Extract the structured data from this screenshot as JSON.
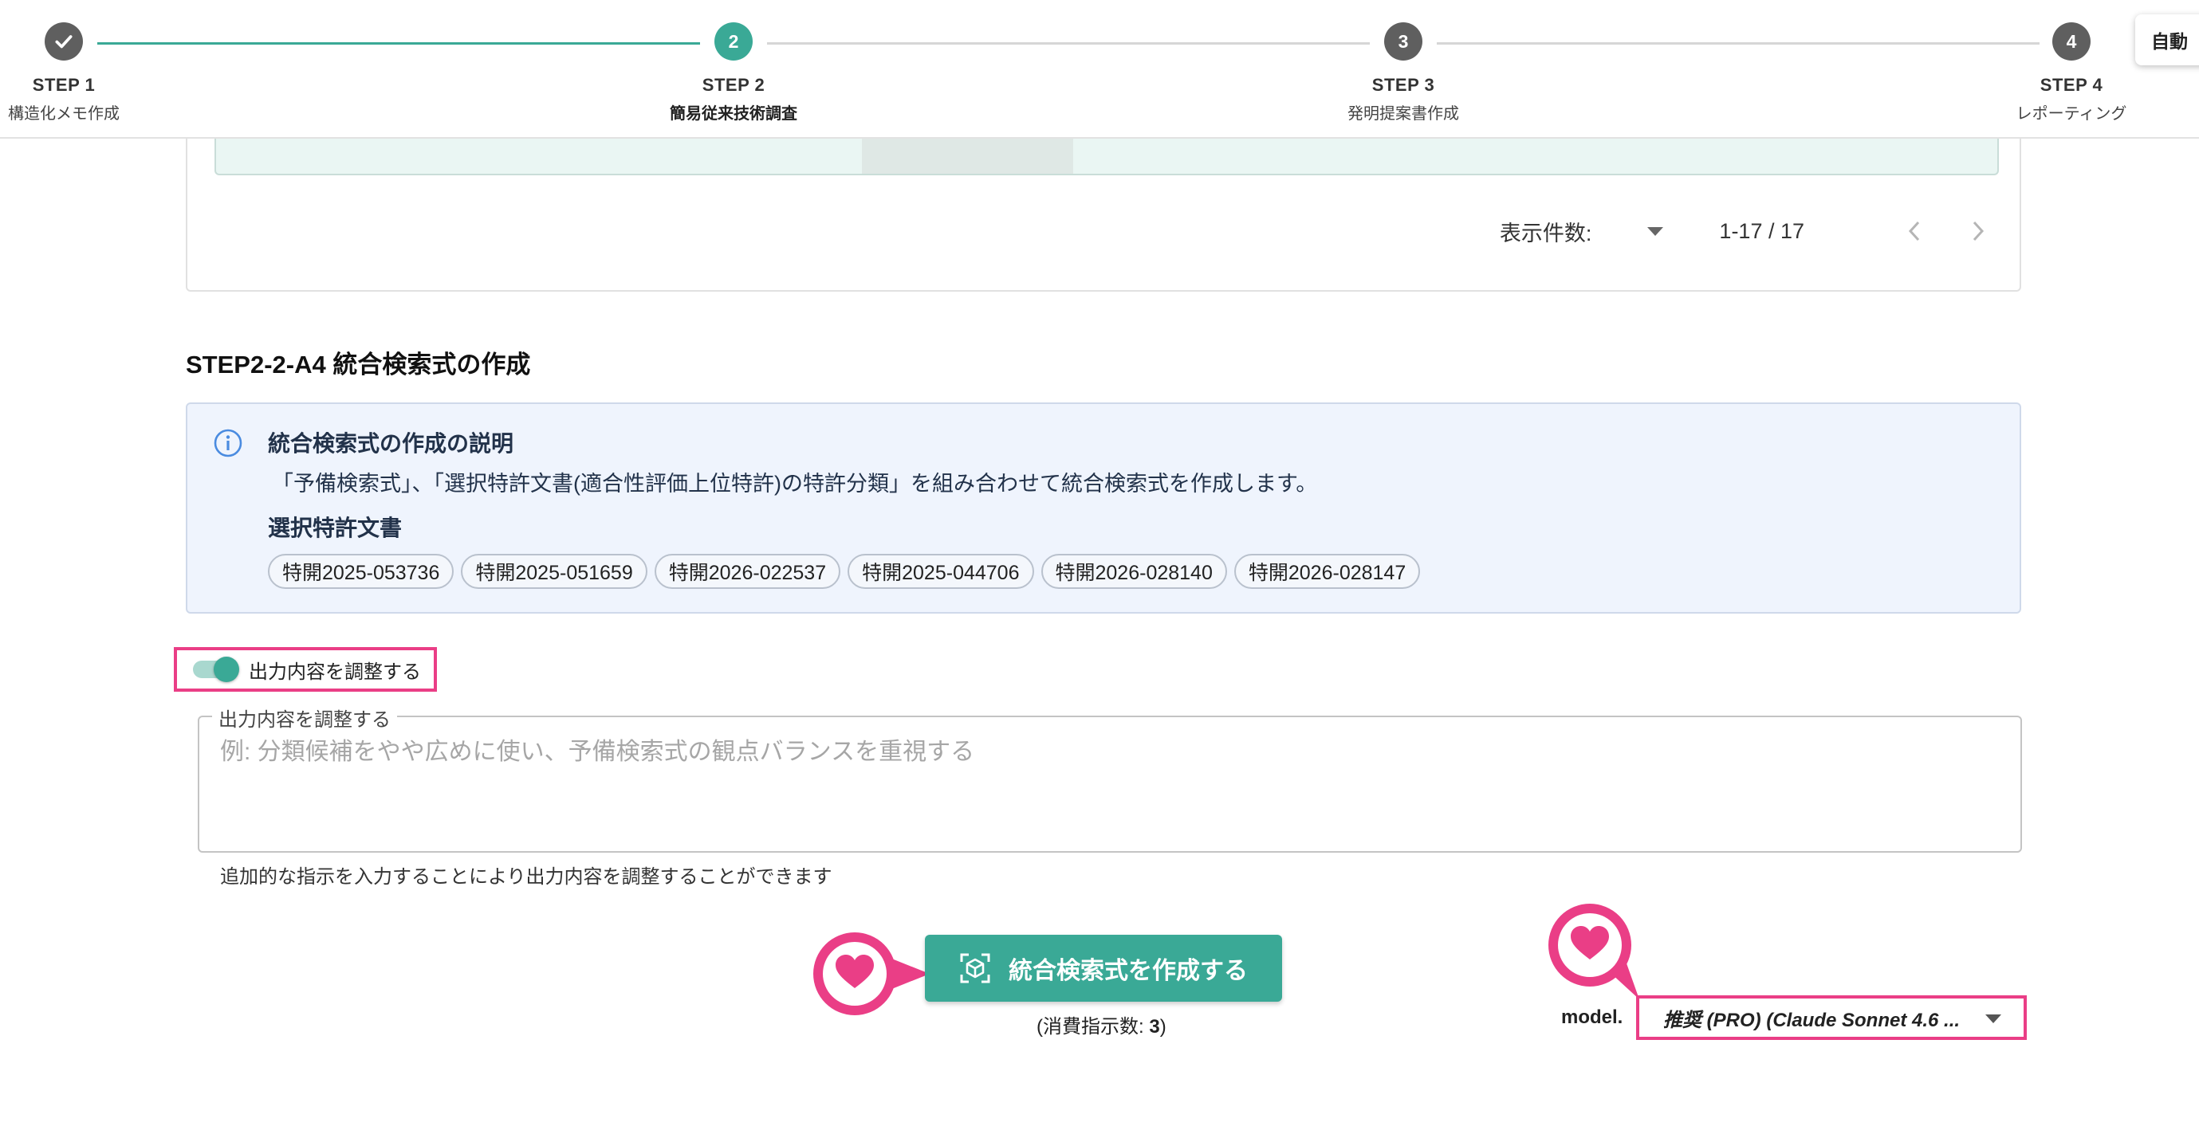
{
  "stepper": {
    "steps": [
      {
        "number": "",
        "title": "STEP 1",
        "subtitle": "構造化メモ作成",
        "state": "complete"
      },
      {
        "number": "2",
        "title": "STEP 2",
        "subtitle": "簡易従来技術調査",
        "state": "active"
      },
      {
        "number": "3",
        "title": "STEP 3",
        "subtitle": "発明提案書作成",
        "state": "pending"
      },
      {
        "number": "4",
        "title": "STEP 4",
        "subtitle": "レポーティング",
        "state": "pending"
      }
    ],
    "auto_button_label": "自動"
  },
  "pagination": {
    "label": "表示件数:",
    "range": "1-17 / 17"
  },
  "section": {
    "title": "STEP2-2-A4 統合検索式の作成",
    "info_title": "統合検索式の作成の説明",
    "info_description": "「予備検索式」、「選択特許文書(適合性評価上位特許)の特許分類」を組み合わせて統合検索式を作成します。",
    "selected_docs_title": "選択特許文書",
    "selected_docs": [
      "特開2025-053736",
      "特開2025-051659",
      "特開2026-022537",
      "特開2025-044706",
      "特開2026-028140",
      "特開2026-028147"
    ]
  },
  "adjust": {
    "toggle_label": "出力内容を調整する",
    "toggle_on": true,
    "field_legend": "出力内容を調整する",
    "field_placeholder": "例: 分類候補をやや広めに使い、予備検索式の観点バランスを重視する",
    "field_value": "",
    "helper_text": "追加的な指示を入力することにより出力内容を調整することができます"
  },
  "action": {
    "create_button_label": "統合検索式を作成する",
    "consume_prefix": "(消費指示数: ",
    "consume_count": "3",
    "consume_suffix": ")"
  },
  "model": {
    "label": "model.",
    "selected": "推奨 (PRO) (Claude Sonnet 4.6 ..."
  },
  "colors": {
    "accent": "#3aa996",
    "highlight": "#ea3e86",
    "info_bg": "#eff4fd",
    "step_inactive": "#5f5f5f"
  },
  "icons": [
    "check-icon",
    "info-icon",
    "chevron-left-icon",
    "chevron-right-icon",
    "caret-down-icon",
    "cube-scan-icon",
    "heart-icon"
  ]
}
